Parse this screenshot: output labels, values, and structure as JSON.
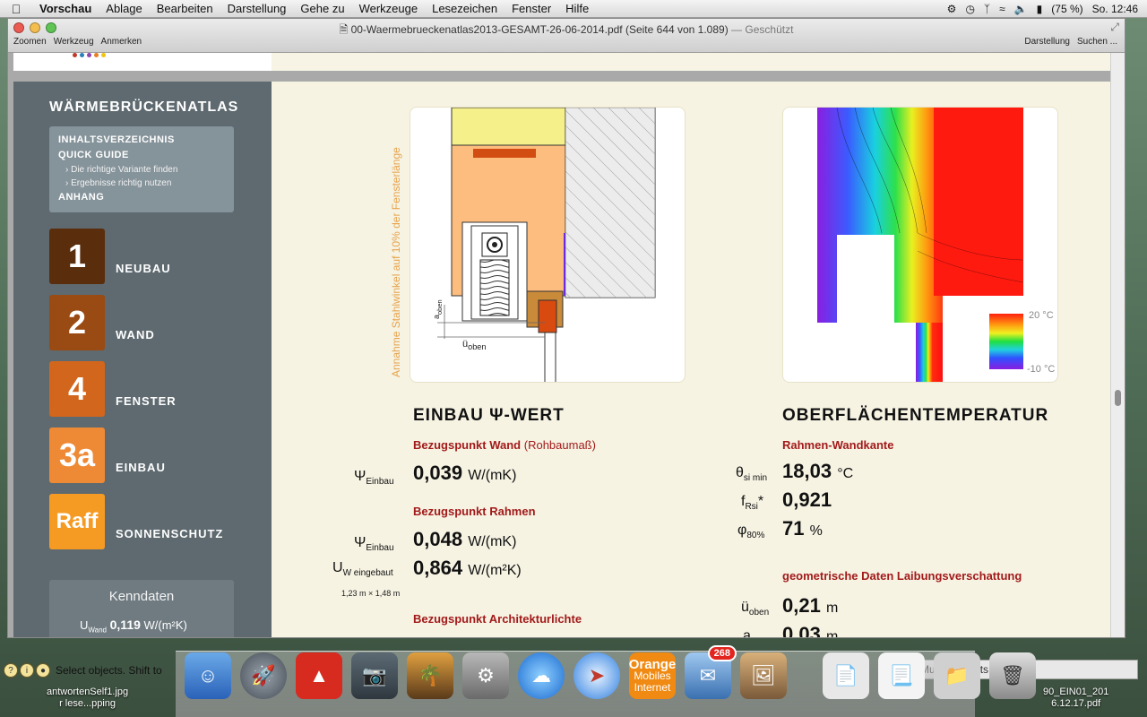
{
  "menubar": {
    "app": "Vorschau",
    "items": [
      "Ablage",
      "Bearbeiten",
      "Darstellung",
      "Gehe zu",
      "Werkzeuge",
      "Lesezeichen",
      "Fenster",
      "Hilfe"
    ],
    "battery": "(75 %)",
    "clock": "So. 12:46"
  },
  "window": {
    "title": "00-Waermebrueckenatlas2013-GESAMT-26-06-2014.pdf (Seite 644 von 1.089)",
    "title_suffix": "— Geschützt",
    "toolbar_left": [
      "Zoomen",
      "Werkzeug",
      "Anmerken"
    ],
    "toolbar_right": [
      "Darstellung",
      "Suchen ..."
    ]
  },
  "sidebar": {
    "title": "WÄRMEBRÜCKENATLAS",
    "toc": {
      "heading1": "INHALTSVERZEICHNIS",
      "heading2": "QUICK GUIDE",
      "sub1": "› Die richtige Variante finden",
      "sub2": "› Ergebnisse richtig nutzen",
      "heading3": "ANHANG"
    },
    "nav": [
      {
        "num": "1",
        "label": "NEUBAU",
        "color": "#5a2d0c"
      },
      {
        "num": "2",
        "label": "WAND",
        "color": "#9a4a13"
      },
      {
        "num": "4",
        "label": "FENSTER",
        "color": "#d2661c"
      },
      {
        "num": "3a",
        "label": "EINBAU",
        "color": "#ee8a36"
      },
      {
        "num": "Raff",
        "label": "SONNENSCHUTZ",
        "color": "#f59a22"
      }
    ],
    "kenndaten": {
      "title": "Kenndaten",
      "symbol": "U",
      "symbol_sub": "Wand",
      "value": "0,119",
      "unit": "W/(m²K)"
    }
  },
  "figures": {
    "vertical_note": "Annahme Stahlwinkel auf 10% der Fensterlänge",
    "label_a": "a",
    "label_a_sub": "oben",
    "label_u": "ü",
    "label_u_sub": "oben",
    "legend_top": "20 °C",
    "legend_bottom": "-10 °C"
  },
  "left_section": {
    "title": "EINBAU Ψ-WERT",
    "ref1": "Bezugspunkt Wand",
    "ref1_extra": "(Rohbaumaß)",
    "psi1_sym": "Ψ",
    "psi1_sub": "Einbau",
    "psi1_val": "0,039",
    "psi1_unit": "W/(mK)",
    "ref2": "Bezugspunkt Rahmen",
    "psi2_sym": "Ψ",
    "psi2_sub": "Einbau",
    "psi2_val": "0,048",
    "psi2_unit": "W/(mK)",
    "uw_sym": "U",
    "uw_sub": "W eingebaut",
    "uw_dim": "1,23 m × 1,48 m",
    "uw_val": "0,864",
    "uw_unit": "W/(m²K)",
    "ref3": "Bezugspunkt Architekturlichte"
  },
  "right_section": {
    "title": "OBERFLÄCHENTEMPERATUR",
    "ref1": "Rahmen-Wandkante",
    "theta_sym": "θ",
    "theta_sub": "si min",
    "theta_val": "18,03",
    "theta_unit": "°C",
    "f_sym": "f",
    "f_sub": "Rsi",
    "f_star": "*",
    "f_val": "0,921",
    "phi_sym": "φ",
    "phi_sub": "80%",
    "phi_val": "71",
    "phi_unit": "%",
    "ref2": "geometrische Daten Laibungsverschattung",
    "u_sym": "ü",
    "u_sub": "oben",
    "u_val": "0,21",
    "u_unit": "m",
    "a_sym": "a",
    "a_val": "0,03",
    "a_unit": "m"
  },
  "status": {
    "text": "Select objects. Shift to"
  },
  "rhs_box": {
    "text": "Mu",
    "text2": "ments"
  },
  "dock": {
    "orange_1": "Orange",
    "orange_2": "Mobiles",
    "orange_3": "Internet",
    "mail_badge": "268"
  },
  "desktop_files": {
    "left_1": "antwortenSelf1.jpg",
    "left_2": "r lese...pping",
    "right_1": "90_EIN01_201",
    "right_2": "6.12.17.pdf"
  }
}
